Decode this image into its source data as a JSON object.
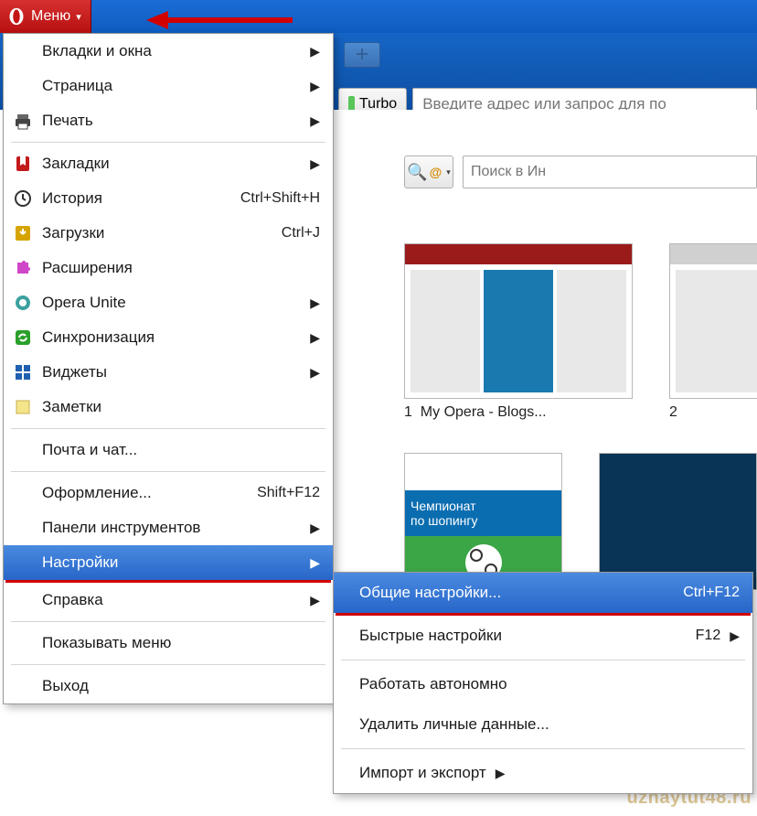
{
  "menu_button": {
    "label": "Меню"
  },
  "toolbar": {
    "turbo": "Turbo",
    "address_placeholder": "Введите адрес или запрос для по"
  },
  "search": {
    "placeholder": "Поиск в Ин"
  },
  "speeddial": {
    "tiles": [
      {
        "index": "1",
        "title": "My Opera - Blogs..."
      },
      {
        "index": "2",
        "title": ""
      }
    ],
    "banner": {
      "line1": "Чемпионат",
      "line2": "по шопингу"
    }
  },
  "main_menu": [
    {
      "icon": null,
      "label": "Вкладки и окна",
      "shortcut": "",
      "submenu": true
    },
    {
      "icon": null,
      "label": "Страница",
      "shortcut": "",
      "submenu": true
    },
    {
      "icon": "printer",
      "label": "Печать",
      "shortcut": "",
      "submenu": true
    },
    {
      "sep": true
    },
    {
      "icon": "bookmark",
      "label": "Закладки",
      "shortcut": "",
      "submenu": true
    },
    {
      "icon": "clock",
      "label": "История",
      "shortcut": "Ctrl+Shift+H",
      "submenu": false
    },
    {
      "icon": "download",
      "label": "Загрузки",
      "shortcut": "Ctrl+J",
      "submenu": false
    },
    {
      "icon": "puzzle",
      "label": "Расширения",
      "shortcut": "",
      "submenu": false
    },
    {
      "icon": "unite",
      "label": "Opera Unite",
      "shortcut": "",
      "submenu": true
    },
    {
      "icon": "sync",
      "label": "Синхронизация",
      "shortcut": "",
      "submenu": true
    },
    {
      "icon": "widget",
      "label": "Виджеты",
      "shortcut": "",
      "submenu": true
    },
    {
      "icon": "note",
      "label": "Заметки",
      "shortcut": "",
      "submenu": false
    },
    {
      "sep": true
    },
    {
      "icon": null,
      "label": "Почта и чат...",
      "shortcut": "",
      "submenu": false
    },
    {
      "sep": true
    },
    {
      "icon": null,
      "label": "Оформление...",
      "shortcut": "Shift+F12",
      "submenu": false
    },
    {
      "icon": null,
      "label": "Панели инструментов",
      "shortcut": "",
      "submenu": true
    },
    {
      "icon": null,
      "label": "Настройки",
      "shortcut": "",
      "submenu": true,
      "highlight": true
    },
    {
      "red": true
    },
    {
      "icon": null,
      "label": "Справка",
      "shortcut": "",
      "submenu": true
    },
    {
      "sep": true
    },
    {
      "icon": null,
      "label": "Показывать меню",
      "shortcut": "",
      "submenu": false
    },
    {
      "sep": true
    },
    {
      "icon": null,
      "label": "Выход",
      "shortcut": "",
      "submenu": false
    }
  ],
  "sub_menu": [
    {
      "label": "Общие настройки...",
      "shortcut": "Ctrl+F12",
      "submenu": false,
      "highlight": true
    },
    {
      "red": true
    },
    {
      "label": "Быстрые настройки",
      "shortcut": "F12",
      "submenu": true
    },
    {
      "sep": true
    },
    {
      "label": "Работать автономно",
      "shortcut": "",
      "submenu": false
    },
    {
      "label": "Удалить личные данные...",
      "shortcut": "",
      "submenu": false
    },
    {
      "sep": true
    },
    {
      "label": "Импорт и экспорт",
      "shortcut": "",
      "submenu": true
    }
  ],
  "watermark": "uznaytut48.ru"
}
